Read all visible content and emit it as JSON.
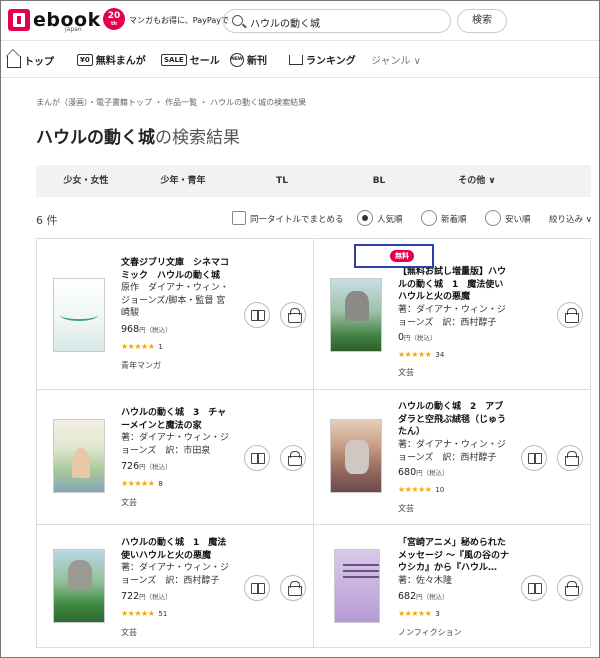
{
  "header": {
    "logo_text": "ebook",
    "logo_sub": "japan",
    "anniv_number": "20",
    "anniv_sub": "th",
    "tagline": "マンガもお得に、PayPayで",
    "search_value": "ハウルの動く城",
    "search_button": "検索"
  },
  "nav": {
    "items": [
      {
        "label": "トップ",
        "icon": "home-icon"
      },
      {
        "label": "無料まんが",
        "icon": "free-icon",
        "icon_text": "¥0"
      },
      {
        "label": "セール",
        "icon": "sale-icon",
        "icon_text": "SALE"
      },
      {
        "label": "新刊",
        "icon": "new-icon",
        "icon_text": "NEW"
      },
      {
        "label": "ランキング",
        "icon": "crown-icon"
      },
      {
        "label": "ジャンル ∨",
        "icon": "chevron-down-icon"
      }
    ]
  },
  "breadcrumb": "まんが（漫画）・電子書籍トップ ・ 作品一覧 ・ ハウルの動く城の検索結果",
  "page_title": {
    "query": "ハウルの動く城",
    "suffix": "の検索結果"
  },
  "category_tabs": [
    "少女・女性",
    "少年・青年",
    "TL",
    "BL",
    "その他 ∨"
  ],
  "result_count": "6 件",
  "sort": {
    "group_label": "同一タイトルでまとめる",
    "options": [
      "人気順",
      "新着順",
      "安い順"
    ],
    "selected": "人気順",
    "filter_label": "絞り込み ∨"
  },
  "results": [
    {
      "title": "文春ジブリ文庫　シネマコミック　ハウルの動く城",
      "author": "原作　ダイアナ・ウィン・ジョーンズ/脚本・監督 宮崎駿",
      "price": "968",
      "tax": "円（税込）",
      "stars": "★★★★★",
      "rating_count": "1",
      "genre": "青年マンガ",
      "cover": "cv1"
    },
    {
      "title": "【無料お試し増量版】ハウルの動く城　1　魔法使いハウルと火の悪魔",
      "author": "著：ダイアナ・ウィン・ジョーンズ　訳：西村醇子",
      "price": "0",
      "tax": "円（税込）",
      "stars": "★★★★★",
      "rating_count": "34",
      "genre": "文芸",
      "badge": "無料",
      "cover": "cv2"
    },
    {
      "title": "ハウルの動く城　3　チャーメインと魔法の家",
      "author": "著：ダイアナ・ウィン・ジョーンズ　訳：市田泉",
      "price": "726",
      "tax": "円（税込）",
      "stars": "★★★★★",
      "rating_count": "8",
      "genre": "文芸",
      "cover": "cv3"
    },
    {
      "title": "ハウルの動く城　2　アブダラと空飛ぶ絨毯（じゅうたん）",
      "author": "著：ダイアナ・ウィン・ジョーンズ　訳：西村醇子",
      "price": "680",
      "tax": "円（税込）",
      "stars": "★★★★★",
      "rating_count": "10",
      "genre": "文芸",
      "cover": "cv4"
    },
    {
      "title": "ハウルの動く城　1　魔法使いハウルと火の悪魔",
      "author": "著：ダイアナ・ウィン・ジョーンズ　訳：西村醇子",
      "price": "722",
      "tax": "円（税込）",
      "stars": "★★★★★",
      "rating_count": "51",
      "genre": "文芸",
      "cover": "cv5"
    },
    {
      "title": "「宮崎アニメ」秘められたメッセージ ～『風の谷のナウシカ』から『ハウル…",
      "author": "著：佐々木隆",
      "price": "682",
      "tax": "円（税込）",
      "stars": "★★★★★",
      "rating_count": "3",
      "genre": "ノンフィクション",
      "cover": "cv6"
    }
  ],
  "colors": {
    "brand": "#e5004f",
    "star": "#f2a900",
    "highlight_box": "#2c3fa3"
  }
}
